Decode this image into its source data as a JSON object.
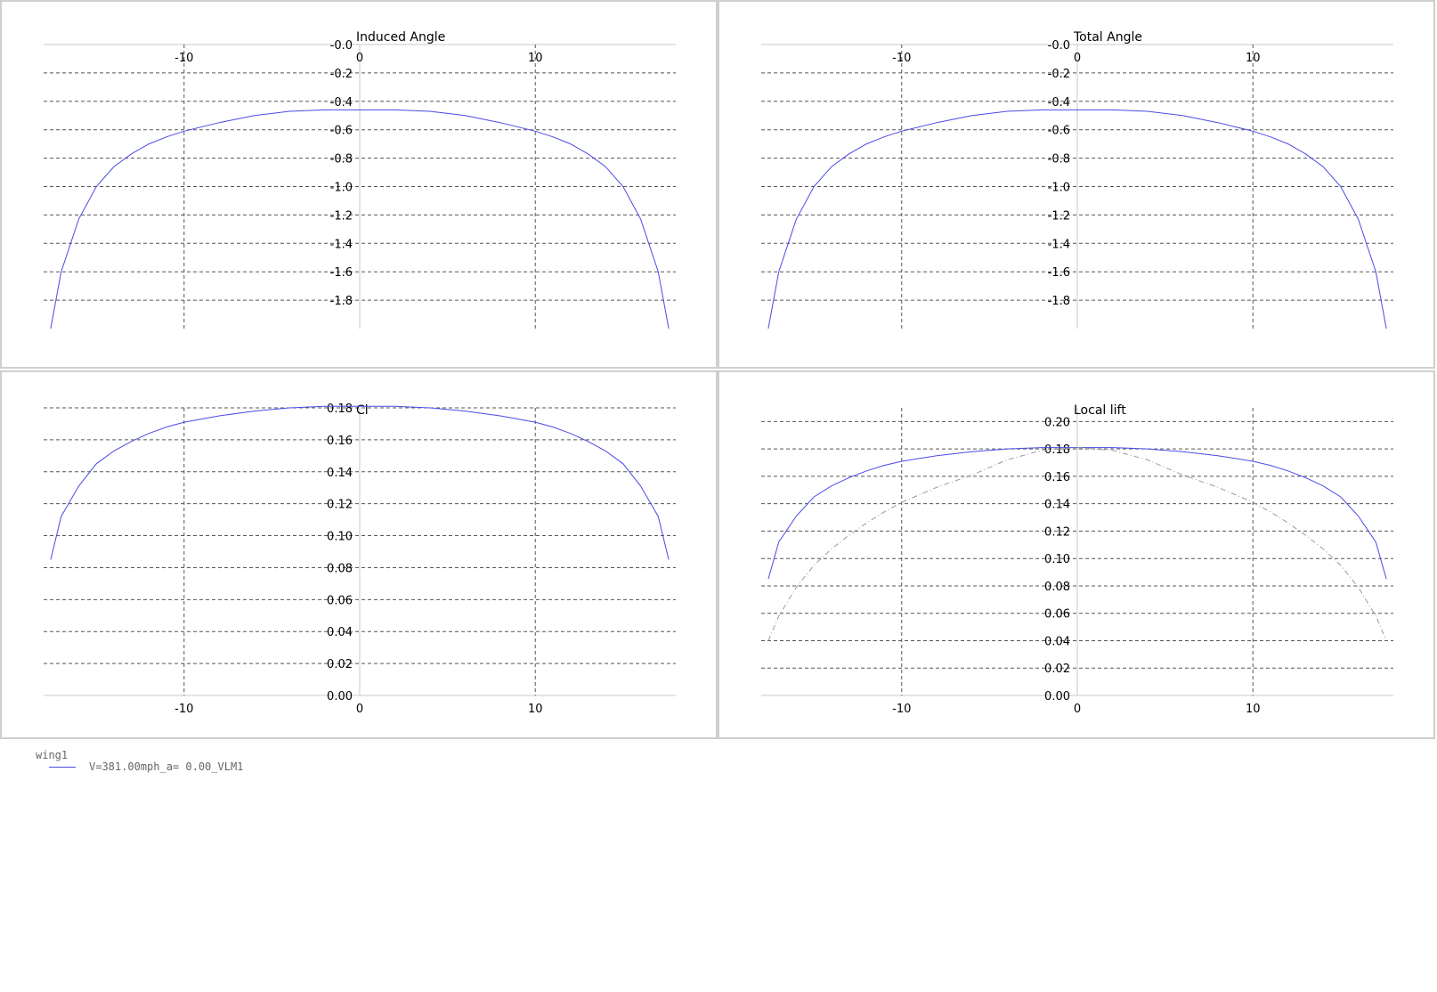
{
  "legend": {
    "object_name": "wing1",
    "entries": [
      {
        "label": "V=381.00mph_a= 0.00_VLM1",
        "color": "#4a4ae8"
      }
    ]
  },
  "chart_data": [
    {
      "type": "line",
      "title": "Induced Angle",
      "xlabel": "",
      "ylabel": "",
      "xlim": [
        -18,
        18
      ],
      "ylim": [
        -2.0,
        0.0
      ],
      "y_inverted": true,
      "x_ticks": [
        -10,
        0,
        10
      ],
      "x_tick_labels": [
        "-10",
        "0",
        "10"
      ],
      "y_ticks": [
        0,
        -0.2,
        -0.4,
        -0.6,
        -0.8,
        -1.0,
        -1.2,
        -1.4,
        -1.6,
        -1.8
      ],
      "y_tick_labels": [
        "-0.0",
        "-0.2",
        "-0.4",
        "-0.6",
        "-0.8",
        "-1.0",
        "-1.2",
        "-1.4",
        "-1.6",
        "-1.8"
      ],
      "x_axis_position": "top",
      "grid": true,
      "series": [
        {
          "color": "#4a4ae8",
          "style": "solid",
          "x": [
            -17.6,
            -17.0,
            -16.0,
            -15.0,
            -14.0,
            -13.0,
            -12.0,
            -11.0,
            -10.0,
            -8.0,
            -6.0,
            -4.0,
            -2.0,
            0.0,
            2.0,
            4.0,
            6.0,
            8.0,
            10.0,
            11.0,
            12.0,
            13.0,
            14.0,
            15.0,
            16.0,
            17.0,
            17.6
          ],
          "y": [
            -2.0,
            -1.6,
            -1.23,
            -1.0,
            -0.86,
            -0.77,
            -0.7,
            -0.65,
            -0.61,
            -0.55,
            -0.5,
            -0.47,
            -0.46,
            -0.46,
            -0.46,
            -0.47,
            -0.5,
            -0.55,
            -0.61,
            -0.65,
            -0.7,
            -0.77,
            -0.86,
            -1.0,
            -1.23,
            -1.6,
            -2.0
          ]
        }
      ]
    },
    {
      "type": "line",
      "title": "Total Angle",
      "xlabel": "",
      "ylabel": "",
      "xlim": [
        -18,
        18
      ],
      "ylim": [
        -2.0,
        0.0
      ],
      "y_inverted": true,
      "x_ticks": [
        -10,
        0,
        10
      ],
      "x_tick_labels": [
        "-10",
        "0",
        "10"
      ],
      "y_ticks": [
        0,
        -0.2,
        -0.4,
        -0.6,
        -0.8,
        -1.0,
        -1.2,
        -1.4,
        -1.6,
        -1.8
      ],
      "y_tick_labels": [
        "-0.0",
        "-0.2",
        "-0.4",
        "-0.6",
        "-0.8",
        "-1.0",
        "-1.2",
        "-1.4",
        "-1.6",
        "-1.8"
      ],
      "x_axis_position": "top",
      "grid": true,
      "series": [
        {
          "color": "#4a4ae8",
          "style": "solid",
          "x": [
            -17.6,
            -17.0,
            -16.0,
            -15.0,
            -14.0,
            -13.0,
            -12.0,
            -11.0,
            -10.0,
            -8.0,
            -6.0,
            -4.0,
            -2.0,
            0.0,
            2.0,
            4.0,
            6.0,
            8.0,
            10.0,
            11.0,
            12.0,
            13.0,
            14.0,
            15.0,
            16.0,
            17.0,
            17.6
          ],
          "y": [
            -2.0,
            -1.6,
            -1.23,
            -1.0,
            -0.86,
            -0.77,
            -0.7,
            -0.65,
            -0.61,
            -0.55,
            -0.5,
            -0.47,
            -0.46,
            -0.46,
            -0.46,
            -0.47,
            -0.5,
            -0.55,
            -0.61,
            -0.65,
            -0.7,
            -0.77,
            -0.86,
            -1.0,
            -1.23,
            -1.6,
            -2.0
          ]
        }
      ]
    },
    {
      "type": "line",
      "title": "Cl",
      "xlabel": "",
      "ylabel": "",
      "xlim": [
        -18,
        18
      ],
      "ylim": [
        0.0,
        0.18
      ],
      "y_inverted": false,
      "x_ticks": [
        -10,
        0,
        10
      ],
      "x_tick_labels": [
        "-10",
        "0",
        "10"
      ],
      "y_ticks": [
        0.0,
        0.02,
        0.04,
        0.06,
        0.08,
        0.1,
        0.12,
        0.14,
        0.16,
        0.18
      ],
      "y_tick_labels": [
        "0.00",
        "0.02",
        "0.04",
        "0.06",
        "0.08",
        "0.10",
        "0.12",
        "0.14",
        "0.16",
        "0.18"
      ],
      "x_axis_position": "bottom",
      "grid": true,
      "series": [
        {
          "color": "#4a4ae8",
          "style": "solid",
          "x": [
            -17.6,
            -17.0,
            -16.0,
            -15.0,
            -14.0,
            -13.0,
            -12.0,
            -11.0,
            -10.0,
            -8.0,
            -6.0,
            -4.0,
            -2.0,
            0.0,
            2.0,
            4.0,
            6.0,
            8.0,
            10.0,
            11.0,
            12.0,
            13.0,
            14.0,
            15.0,
            16.0,
            17.0,
            17.6
          ],
          "y": [
            0.085,
            0.112,
            0.131,
            0.145,
            0.153,
            0.159,
            0.164,
            0.168,
            0.171,
            0.175,
            0.178,
            0.18,
            0.181,
            0.181,
            0.181,
            0.18,
            0.178,
            0.175,
            0.171,
            0.168,
            0.164,
            0.159,
            0.153,
            0.145,
            0.131,
            0.112,
            0.085
          ]
        }
      ]
    },
    {
      "type": "line",
      "title": "Local lift",
      "xlabel": "",
      "ylabel": "",
      "xlim": [
        -18,
        18
      ],
      "ylim": [
        0.0,
        0.21
      ],
      "y_inverted": false,
      "x_ticks": [
        -10,
        0,
        10
      ],
      "x_tick_labels": [
        "-10",
        "0",
        "10"
      ],
      "y_ticks": [
        0.0,
        0.02,
        0.04,
        0.06,
        0.08,
        0.1,
        0.12,
        0.14,
        0.16,
        0.18,
        0.2
      ],
      "y_tick_labels": [
        "0.00",
        "0.02",
        "0.04",
        "0.06",
        "0.08",
        "0.10",
        "0.12",
        "0.14",
        "0.16",
        "0.18",
        "0.20"
      ],
      "x_axis_position": "bottom",
      "grid": true,
      "series": [
        {
          "color": "#4a4ae8",
          "style": "solid",
          "x": [
            -17.6,
            -17.0,
            -16.0,
            -15.0,
            -14.0,
            -13.0,
            -12.0,
            -11.0,
            -10.0,
            -8.0,
            -6.0,
            -4.0,
            -2.0,
            0.0,
            2.0,
            4.0,
            6.0,
            8.0,
            10.0,
            11.0,
            12.0,
            13.0,
            14.0,
            15.0,
            16.0,
            17.0,
            17.6
          ],
          "y": [
            0.085,
            0.112,
            0.131,
            0.145,
            0.153,
            0.159,
            0.164,
            0.168,
            0.171,
            0.175,
            0.178,
            0.18,
            0.181,
            0.181,
            0.181,
            0.18,
            0.178,
            0.175,
            0.171,
            0.168,
            0.164,
            0.159,
            0.153,
            0.145,
            0.131,
            0.112,
            0.085
          ]
        },
        {
          "color": "#9a9a9a",
          "style": "dashed",
          "x": [
            -17.6,
            -17.0,
            -16.0,
            -15.0,
            -14.0,
            -13.0,
            -12.0,
            -11.0,
            -10.0,
            -8.0,
            -6.0,
            -4.0,
            -2.0,
            0.0,
            2.0,
            4.0,
            6.0,
            8.0,
            10.0,
            11.0,
            12.0,
            13.0,
            14.0,
            15.0,
            16.0,
            17.0,
            17.6
          ],
          "y": [
            0.04,
            0.058,
            0.079,
            0.095,
            0.107,
            0.117,
            0.126,
            0.134,
            0.141,
            0.152,
            0.161,
            0.172,
            0.179,
            0.181,
            0.179,
            0.172,
            0.161,
            0.152,
            0.141,
            0.134,
            0.126,
            0.117,
            0.107,
            0.095,
            0.079,
            0.058,
            0.04
          ]
        }
      ]
    }
  ]
}
